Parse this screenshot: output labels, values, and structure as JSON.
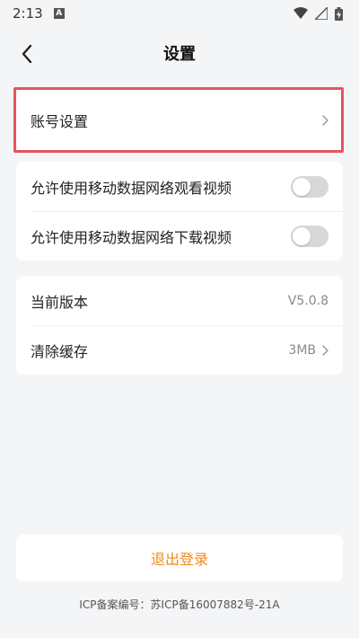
{
  "status_bar": {
    "time": "2:13",
    "notification_glyph": "A",
    "icons": [
      "wifi-icon",
      "signal-icon",
      "battery-charging-icon"
    ]
  },
  "header": {
    "title": "设置",
    "back_icon": "chevron-left-icon"
  },
  "account": {
    "label": "账号设置",
    "chevron_icon": "chevron-right-icon",
    "highlighted": true
  },
  "network": {
    "items": [
      {
        "label": "允许使用移动数据网络观看视频",
        "enabled": false
      },
      {
        "label": "允许使用移动数据网络下载视频",
        "enabled": false
      }
    ]
  },
  "about": {
    "version_label": "当前版本",
    "version_value": "V5.0.8",
    "cache_label": "清除缓存",
    "cache_value": "3MB"
  },
  "logout_label": "退出登录",
  "icp_text": "ICP备案编号：苏ICP备16007882号-21A",
  "colors": {
    "background": "#f4f5f7",
    "highlight_border": "#e8535d",
    "logout_text": "#f08a1c",
    "toggle_off": "#d8d8d8"
  }
}
